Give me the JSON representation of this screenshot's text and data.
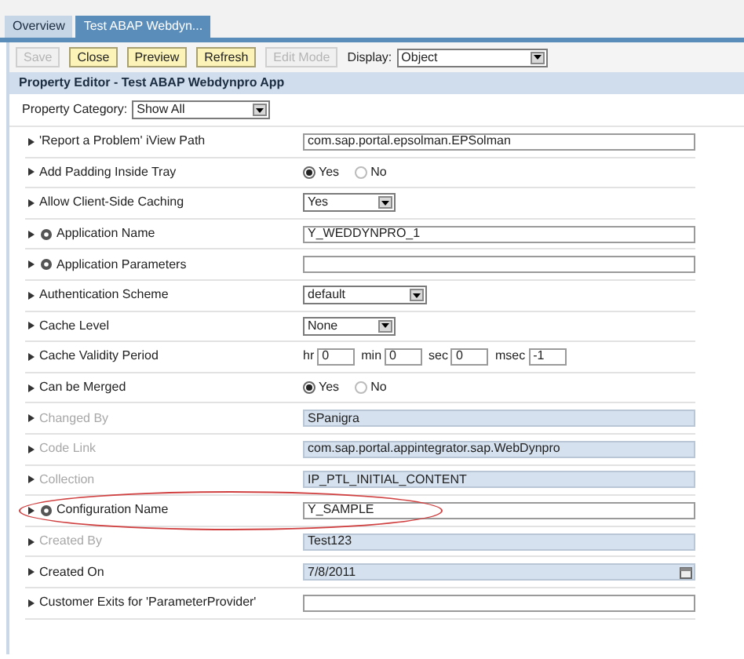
{
  "tabs": [
    {
      "label": "Overview",
      "selected": false
    },
    {
      "label": "Test ABAP Webdyn...",
      "selected": true
    }
  ],
  "toolbar": {
    "buttons": [
      {
        "label": "Save",
        "disabled": true
      },
      {
        "label": "Close",
        "disabled": false
      },
      {
        "label": "Preview",
        "disabled": false
      },
      {
        "label": "Refresh",
        "disabled": false
      },
      {
        "label": "Edit Mode",
        "disabled": true
      }
    ],
    "display_label": "Display:",
    "display_value": "Object"
  },
  "header": "Property Editor - Test ABAP Webdynpro App",
  "category": {
    "label": "Property Category:",
    "value": "Show All"
  },
  "properties": [
    {
      "label": "'Report a Problem' iView Path",
      "kind": "text",
      "value": "com.sap.portal.epsolman.EPSolman",
      "has_icon": false,
      "disabled": false,
      "highlighted": false
    },
    {
      "label": "Add Padding Inside Tray",
      "kind": "radio",
      "options": [
        {
          "label": "Yes",
          "selected": true
        },
        {
          "label": "No",
          "selected": false
        }
      ],
      "has_icon": false,
      "disabled": false,
      "highlighted": false
    },
    {
      "label": "Allow Client-Side Caching",
      "kind": "select",
      "value": "Yes",
      "has_icon": false,
      "disabled": false,
      "highlighted": false
    },
    {
      "label": "Application Name",
      "kind": "text",
      "value": "Y_WEDDYNPRO_1",
      "has_icon": true,
      "disabled": false,
      "highlighted": false
    },
    {
      "label": "Application Parameters",
      "kind": "text",
      "has_icon": true,
      "disabled": false,
      "highlighted": false
    },
    {
      "label": "Authentication Scheme",
      "kind": "select",
      "value": "default",
      "has_icon": false,
      "disabled": false,
      "highlighted": false
    },
    {
      "label": "Cache Level",
      "kind": "select",
      "value": "None",
      "has_icon": false,
      "disabled": false,
      "highlighted": false
    },
    {
      "label": "Cache Validity Period",
      "kind": "timing",
      "parts": [
        {
          "unit": "hr",
          "value": "0"
        },
        {
          "unit": "min",
          "value": "0"
        },
        {
          "unit": "sec",
          "value": "0"
        },
        {
          "unit": "msec",
          "value": "-1"
        }
      ],
      "has_icon": false,
      "disabled": false,
      "highlighted": false
    },
    {
      "label": "Can be Merged",
      "kind": "radio",
      "options": [
        {
          "label": "Yes",
          "selected": true
        },
        {
          "label": "No",
          "selected": false
        }
      ],
      "has_icon": false,
      "disabled": false,
      "highlighted": false
    },
    {
      "label": "Changed By",
      "kind": "readonly",
      "value": "SPanigra",
      "has_icon": false,
      "disabled": true,
      "highlighted": false
    },
    {
      "label": "Code Link",
      "kind": "readonly",
      "value": "com.sap.portal.appintegrator.sap.WebDynpro",
      "has_icon": false,
      "disabled": true,
      "highlighted": false
    },
    {
      "label": "Collection",
      "kind": "readonly",
      "value": "IP_PTL_INITIAL_CONTENT",
      "has_icon": false,
      "disabled": true,
      "highlighted": false
    },
    {
      "label": "Configuration Name",
      "kind": "text",
      "value": "Y_SAMPLE",
      "has_icon": true,
      "disabled": false,
      "highlighted": true
    },
    {
      "label": "Created By",
      "kind": "readonly",
      "value": "Test123",
      "has_icon": false,
      "disabled": true,
      "highlighted": false
    },
    {
      "label": "Created On",
      "kind": "date",
      "value": "7/8/2011",
      "has_icon": false,
      "disabled": false,
      "highlighted": false
    },
    {
      "label": "Customer Exits for 'ParameterProvider'",
      "kind": "text",
      "has_icon": false,
      "disabled": false,
      "highlighted": false
    }
  ]
}
